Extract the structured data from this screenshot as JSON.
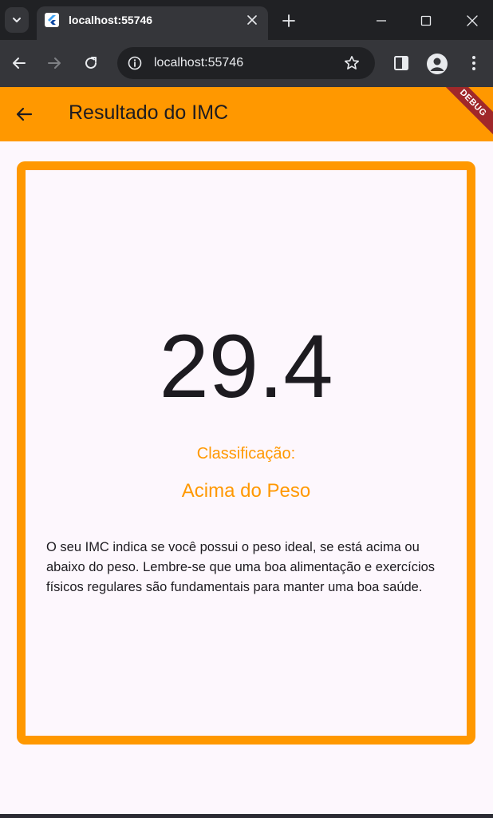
{
  "browser": {
    "tab_title": "localhost:55746",
    "url": "localhost:55746",
    "icons": {
      "tab_search": "chevron-down-icon",
      "favicon": "flutter-icon",
      "tab_close": "close-icon",
      "new_tab": "plus-icon",
      "minimize": "minimize-icon",
      "maximize": "maximize-icon",
      "close_window": "close-icon",
      "back": "arrow-left-icon",
      "forward": "arrow-right-icon",
      "reload": "reload-icon",
      "site_info": "info-icon",
      "bookmark": "star-icon",
      "side_panel": "side-panel-icon",
      "profile": "profile-icon",
      "menu": "more-vert-icon"
    }
  },
  "appbar": {
    "title": "Resultado do IMC",
    "back_icon": "arrow-left-icon",
    "debug_label": "DEBUG"
  },
  "result": {
    "imc": "29.4",
    "classification_label": "Classificação:",
    "classification": "Acima do Peso",
    "description": "O seu IMC indica se você possui o peso ideal, se está acima ou abaixo do peso. Lembre-se que uma boa alimentação e exercícios físicos regulares são fundamentais para manter uma boa saúde."
  },
  "colors": {
    "accent": "#ff9800",
    "background": "#fdf7fd",
    "text": "#1d1b20",
    "debug_banner": "#a0282a"
  }
}
